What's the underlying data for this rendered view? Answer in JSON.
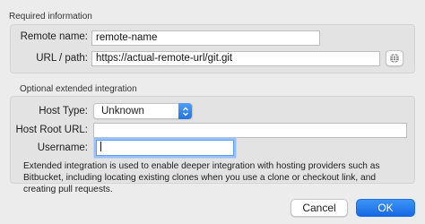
{
  "required": {
    "title": "Required information",
    "remote_name_label": "Remote name:",
    "remote_name_value": "remote-name",
    "url_label": "URL / path:",
    "url_value": "https://actual-remote-url/git.git",
    "globe_icon": "globe-icon"
  },
  "optional": {
    "title": "Optional extended integration",
    "host_type_label": "Host Type:",
    "host_type_value": "Unknown",
    "host_root_label": "Host Root URL:",
    "host_root_value": "",
    "username_label": "Username:",
    "username_value": "",
    "note": "Extended integration is used to enable deeper integration with hosting providers such as Bitbucket, including locating existing clones when you use a clone or checkout link, and creating pull requests."
  },
  "buttons": {
    "cancel": "Cancel",
    "ok": "OK"
  },
  "colors": {
    "accent": "#2473e6",
    "focus_ring": "#9ac1fb"
  }
}
